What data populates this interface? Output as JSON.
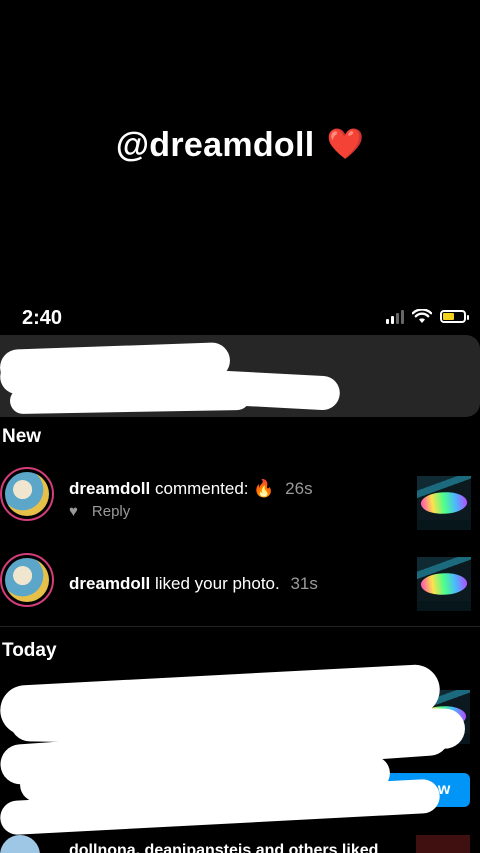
{
  "story": {
    "caption": "@dreamdoll",
    "emoji": "❤️"
  },
  "status_bar": {
    "time": "2:40",
    "battery_level": 0.55
  },
  "sections": {
    "new_title": "New",
    "today_title": "Today"
  },
  "notifications": [
    {
      "username": "dreamdoll",
      "action": "commented:",
      "emoji": "🔥",
      "time_ago": "26s",
      "reply_label": "Reply"
    },
    {
      "username": "dreamdoll",
      "action": "liked your photo.",
      "time_ago": "31s"
    }
  ],
  "today": {
    "follow_label": "Follow",
    "partial_text": "dollnona, deanipansteis and others liked"
  },
  "colors": {
    "background": "#000000",
    "follow_button": "#0095f6",
    "story_ring": "#d23d7a",
    "battery": "#f2d21b"
  }
}
